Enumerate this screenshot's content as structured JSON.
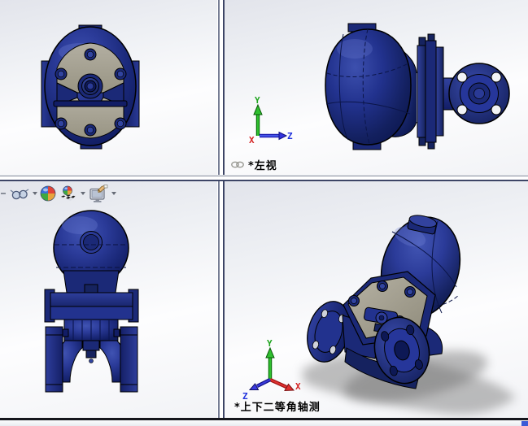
{
  "app": {
    "description": "CAD four-viewport part window"
  },
  "viewports": {
    "top_left": {
      "name": "top-view",
      "label": ""
    },
    "top_right": {
      "name": "left-view",
      "label": "*左视"
    },
    "bottom_left": {
      "name": "front-view",
      "label": ""
    },
    "bottom_right": {
      "name": "dimetric-view",
      "label": "*上下二等角轴测"
    }
  },
  "axis_triad": {
    "x_label": "X",
    "y_label": "Y",
    "z_label": "Z"
  },
  "toolbar": {
    "icons": [
      {
        "name": "hide-show-items",
        "glyph": "glasses",
        "has_dropdown": true
      },
      {
        "name": "edit-appearance",
        "glyph": "colored-ball",
        "has_dropdown": false
      },
      {
        "name": "apply-scene",
        "glyph": "ball-on-checkerboard",
        "has_dropdown": true
      },
      {
        "name": "view-settings",
        "glyph": "monitor-with-hand",
        "has_dropdown": true
      }
    ]
  },
  "colors": {
    "part_body_navy": "#1b2977",
    "part_body_highlight": "#4053b2",
    "part_body_shadow": "#0e1a5e",
    "part_cover_tan": "#a9a496",
    "axis_x_red": "#d42222",
    "axis_y_green": "#1fa51f",
    "axis_z_blue": "#2233dd",
    "background_top": "#e2e4eb",
    "background_bottom": "#f2f3f6",
    "splitter_dark": "#3d4566",
    "window_edge_blue": "#3b5bd6"
  }
}
